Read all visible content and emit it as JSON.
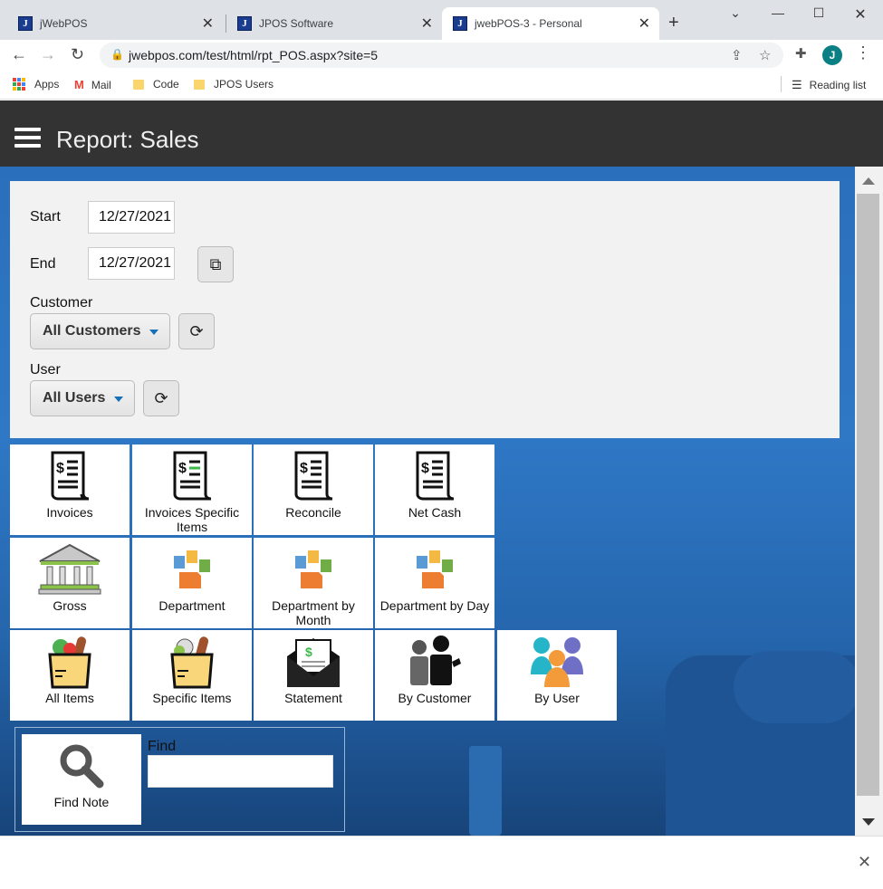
{
  "browser": {
    "tabs": [
      {
        "title": "jWebPOS",
        "fav": "J"
      },
      {
        "title": "JPOS Software",
        "fav": "J"
      },
      {
        "title": "jwebPOS-3 - Personal",
        "fav": "J"
      }
    ],
    "url": "jwebpos.com/test/html/rpt_POS.aspx?site=5",
    "profile_initial": "J",
    "bookmarks": [
      "Apps",
      "Mail",
      "Code",
      "JPOS Users"
    ],
    "reading_list": "Reading list"
  },
  "header": {
    "title": "Report: Sales"
  },
  "filters": {
    "start_label": "Start",
    "start_value": "12/27/2021",
    "end_label": "End",
    "end_value": "12/27/2021",
    "customer_label": "Customer",
    "customer_value": "All Customers",
    "user_label": "User",
    "user_value": "All Users"
  },
  "tiles": [
    {
      "label": "Invoices",
      "icon": "receipt-icon"
    },
    {
      "label": "Invoices Specific Items",
      "icon": "receipt-icon"
    },
    {
      "label": "Reconcile",
      "icon": "receipt-icon"
    },
    {
      "label": "Net Cash",
      "icon": "receipt-icon"
    },
    {
      "label": "Gross",
      "icon": "bank-icon"
    },
    {
      "label": "Department",
      "icon": "department-icon"
    },
    {
      "label": "Department by Month",
      "icon": "department-icon"
    },
    {
      "label": "Department by Day",
      "icon": "department-icon"
    },
    {
      "label": "All Items",
      "icon": "grocery-bag-icon"
    },
    {
      "label": "Specific Items",
      "icon": "grocery-bag-icon"
    },
    {
      "label": "Statement",
      "icon": "envelope-statement-icon"
    },
    {
      "label": "By Customer",
      "icon": "customer-icon"
    },
    {
      "label": "By User",
      "icon": "users-icon"
    }
  ],
  "find": {
    "tile_label": "Find Note",
    "label": "Find",
    "value": ""
  },
  "colors": {
    "header_bg": "#333333",
    "accent": "#1670b8",
    "content_bg": "#2f78c6"
  }
}
